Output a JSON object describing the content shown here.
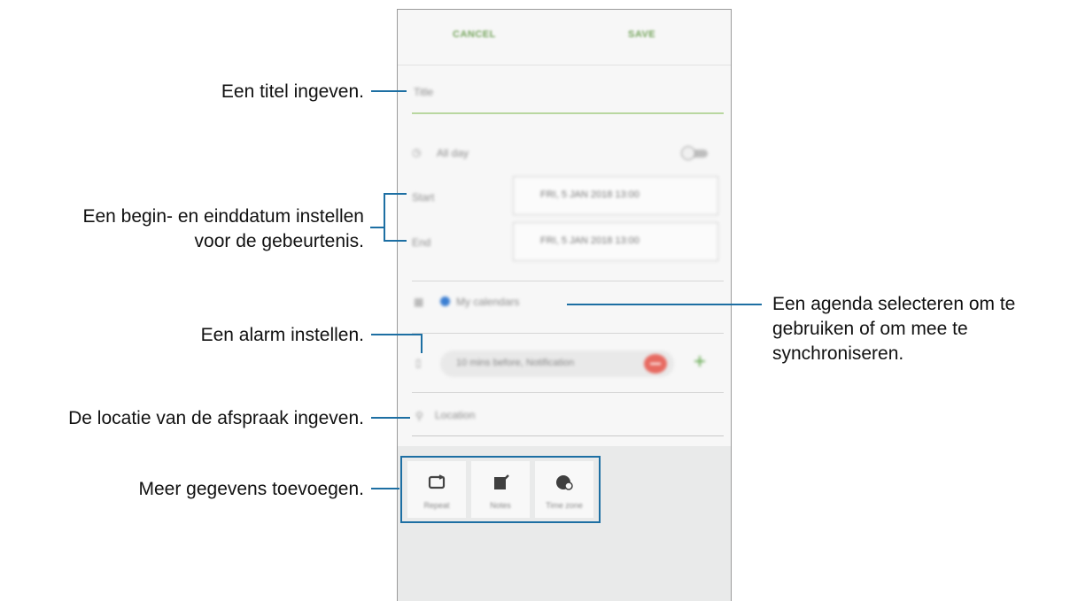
{
  "callouts": {
    "title": "Een titel ingeven.",
    "dates_line1": "Een begin- en einddatum instellen",
    "dates_line2": "voor de gebeurtenis.",
    "alarm": "Een alarm instellen.",
    "location": "De locatie van de afspraak ingeven.",
    "more": "Meer gegevens toevoegen.",
    "calendar_line1": "Een agenda selecteren om te",
    "calendar_line2": "gebruiken of om mee te",
    "calendar_line3": "synchroniseren."
  },
  "phone": {
    "cancel_label": "CANCEL",
    "save_label": "SAVE",
    "title_placeholder": "Title",
    "allday_label": "All day",
    "start_label": "Start",
    "end_label": "End",
    "start_value": "FRI, 5 JAN 2018   13:00",
    "end_value": "FRI, 5 JAN 2018   13:00",
    "calendar_value": "My calendars",
    "alarm_value": "10 mins before, Notification",
    "location_placeholder": "Location",
    "tiles": [
      {
        "label": "Repeat",
        "icon": "repeat-icon"
      },
      {
        "label": "Notes",
        "icon": "notes-icon"
      },
      {
        "label": "Time zone",
        "icon": "time-zone-icon"
      }
    ]
  },
  "colors": {
    "accent_green": "#73a35a",
    "callout_blue": "#1d6fa3",
    "minus_red": "#e76a61",
    "calendar_blue": "#3c7fd2"
  }
}
